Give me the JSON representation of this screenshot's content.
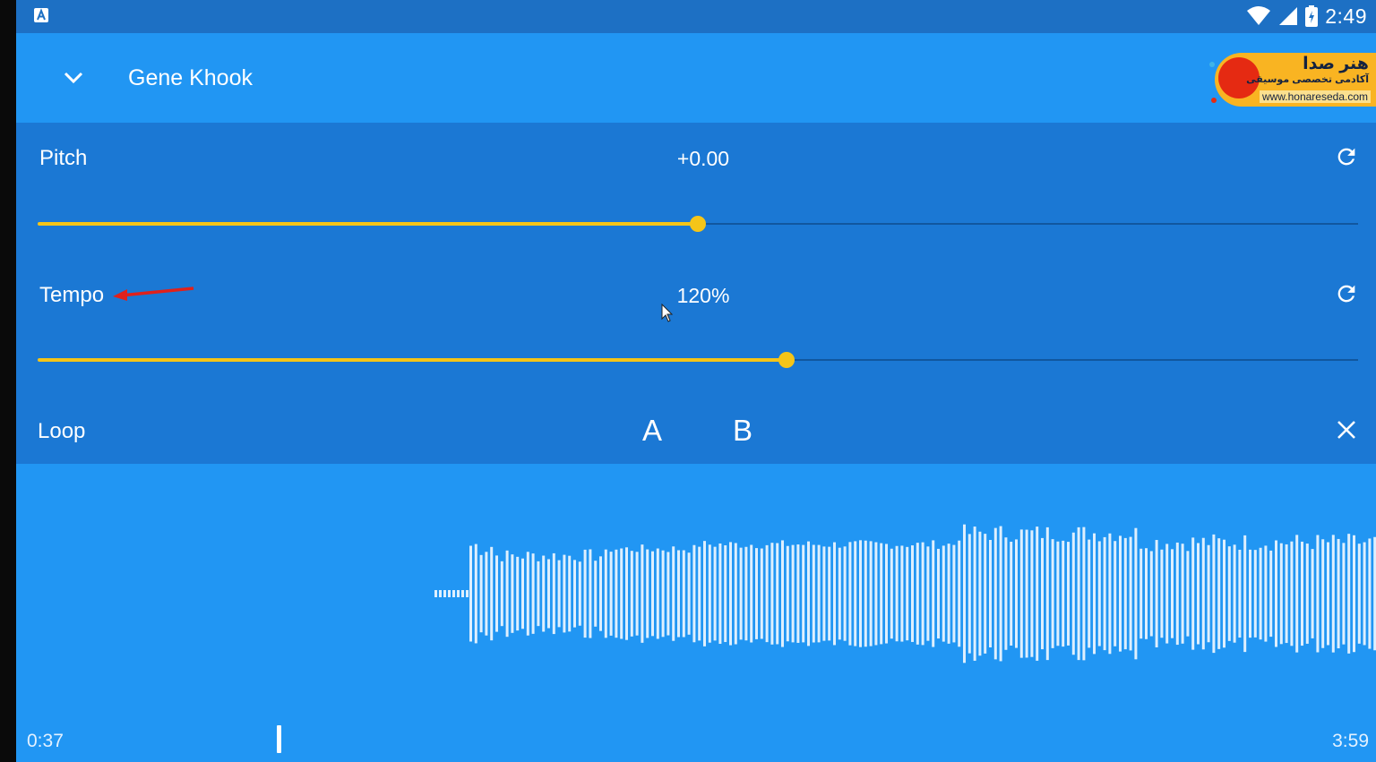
{
  "status_bar": {
    "time": "2:49",
    "icons": [
      "app-notification-icon",
      "wifi-icon",
      "cell-signal-icon",
      "battery-charging-icon"
    ]
  },
  "header": {
    "title": "Gene Khook",
    "collapse_icon": "chevron-down-icon"
  },
  "watermark": {
    "name": "هنر صدا",
    "subtitle": "آکادمی تخصصی موسیقی",
    "url": "www.honareseda.com"
  },
  "pitch": {
    "label": "Pitch",
    "value": "+0.00",
    "slider_fraction": 0.5,
    "reset_icon": "refresh-icon"
  },
  "tempo": {
    "label": "Tempo",
    "value": "120%",
    "slider_fraction": 0.567,
    "reset_icon": "refresh-icon"
  },
  "loop": {
    "label": "Loop",
    "marker_a": "A",
    "marker_b": "B",
    "clear_icon": "close-icon"
  },
  "playback": {
    "current_time": "0:37",
    "total_time": "3:59",
    "position_fraction": 0.155
  },
  "colors": {
    "status_bar": "#1d70c4",
    "app_bar": "#2196f3",
    "controls_panel": "#1b78d4",
    "accent": "#f5c518",
    "annotation_arrow": "#e0211b"
  }
}
